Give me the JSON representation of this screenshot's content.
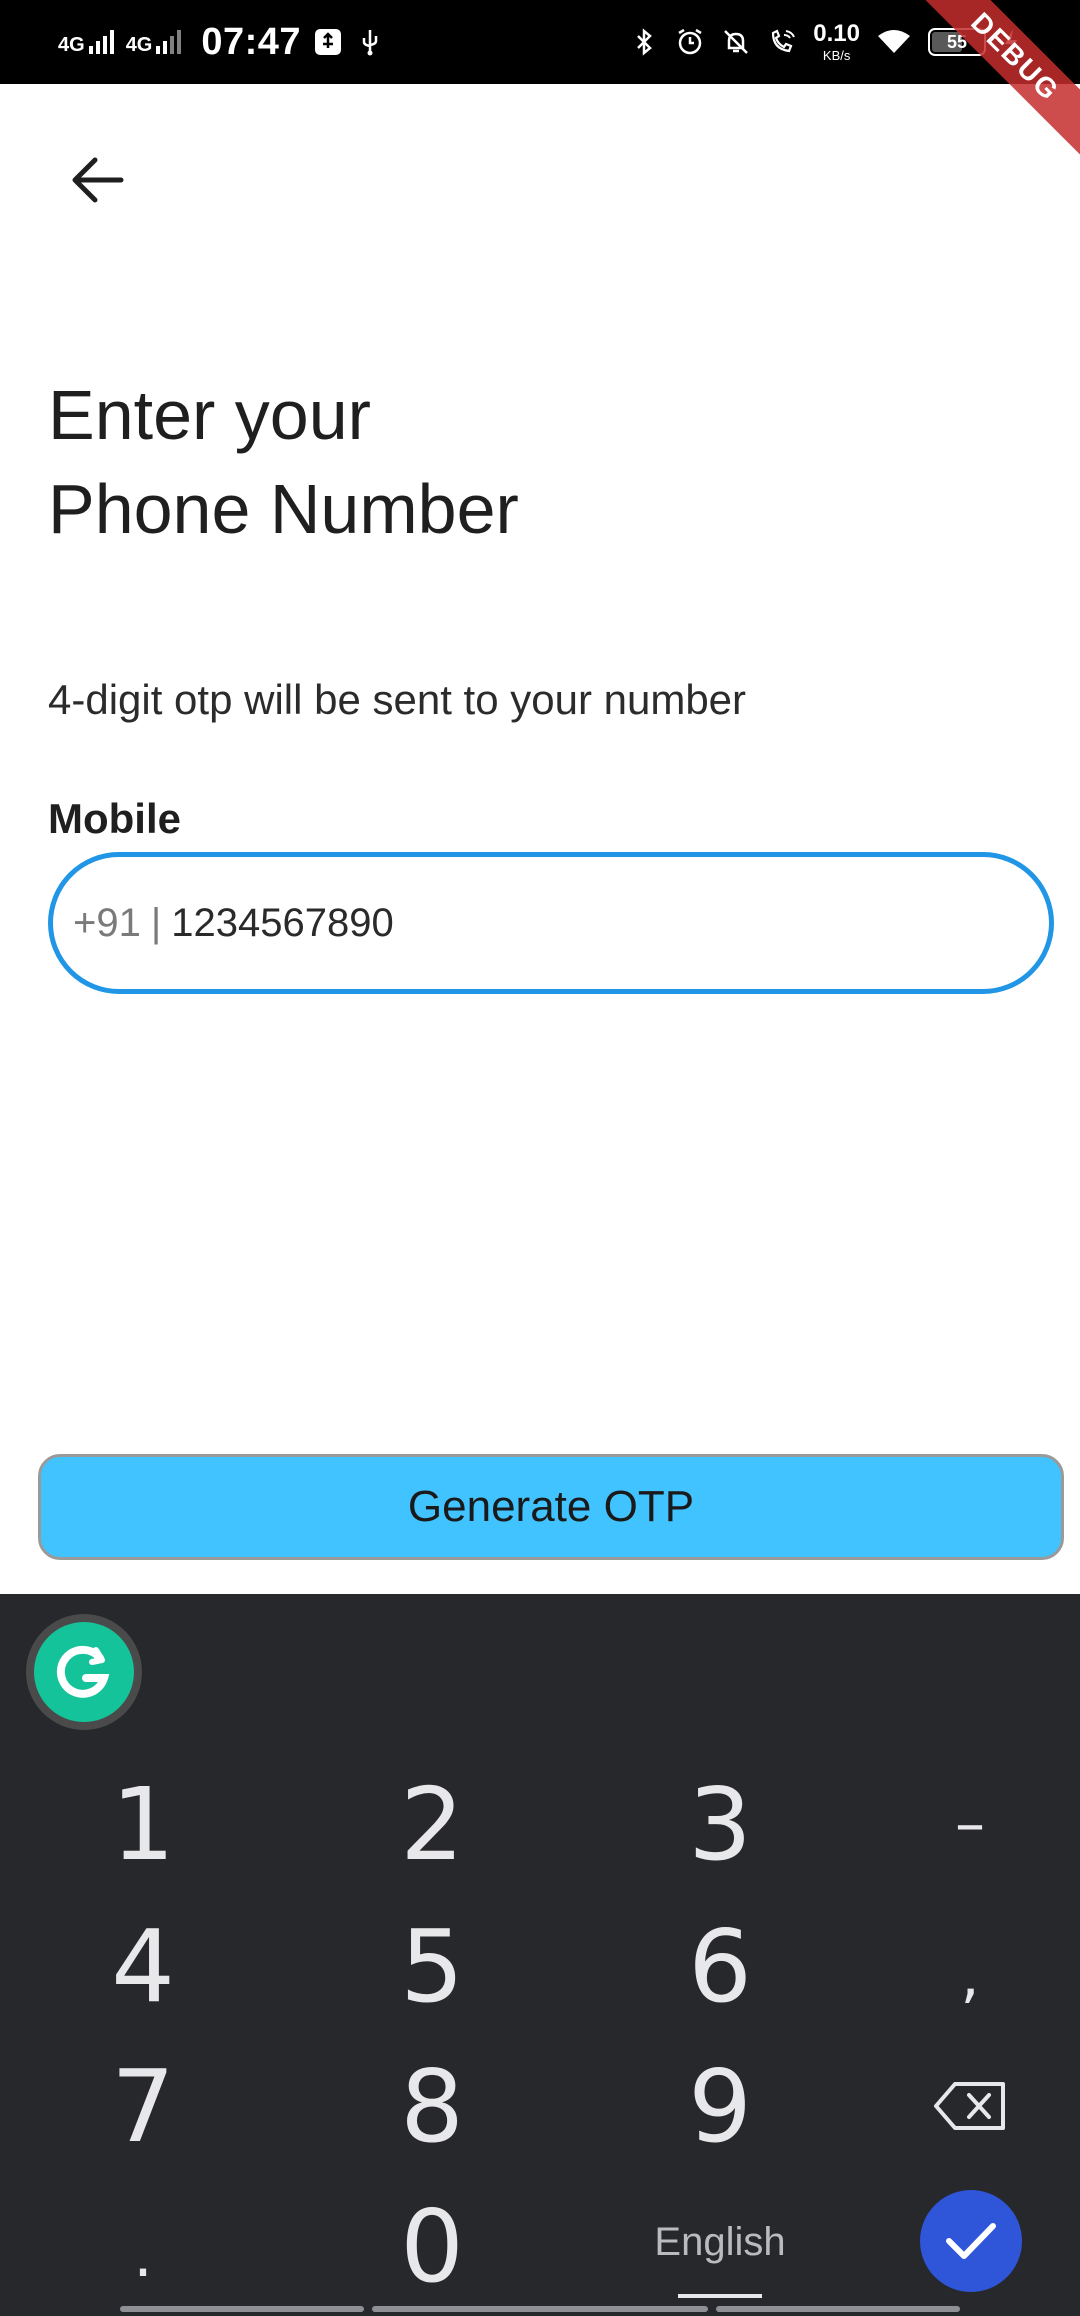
{
  "status_bar": {
    "signal1_label": "4G",
    "signal2_label": "4G",
    "time": "07:47",
    "net_speed_value": "0.10",
    "net_speed_unit": "KB/s",
    "battery": "55",
    "debug_label": "DEBUG"
  },
  "header": {
    "back_icon": "arrow-left-icon"
  },
  "main": {
    "title_line1": "Enter your",
    "title_line2": "Phone Number",
    "subtitle": "4-digit otp will be sent to your number",
    "mobile_label": "Mobile",
    "country_code": "+91",
    "separator": "|",
    "phone_value": "1234567890",
    "focus_color": "#2196e6",
    "cta_label": "Generate OTP",
    "cta_color": "#41c3ff"
  },
  "keyboard": {
    "assistant_icon": "grammarly-icon",
    "rows": [
      [
        "1",
        "2",
        "3",
        "–"
      ],
      [
        "4",
        "5",
        "6",
        ","
      ],
      [
        "7",
        "8",
        "9",
        "backspace-icon"
      ],
      [
        ".",
        "0",
        "English",
        "check-icon"
      ]
    ],
    "key_1": "1",
    "key_2": "2",
    "key_3": "3",
    "key_dash": "–",
    "key_4": "4",
    "key_5": "5",
    "key_6": "6",
    "key_comma": ",",
    "key_7": "7",
    "key_8": "8",
    "key_9": "9",
    "key_dot": ".",
    "key_0": "0",
    "language": "English",
    "done_color": "#2f55d8"
  }
}
